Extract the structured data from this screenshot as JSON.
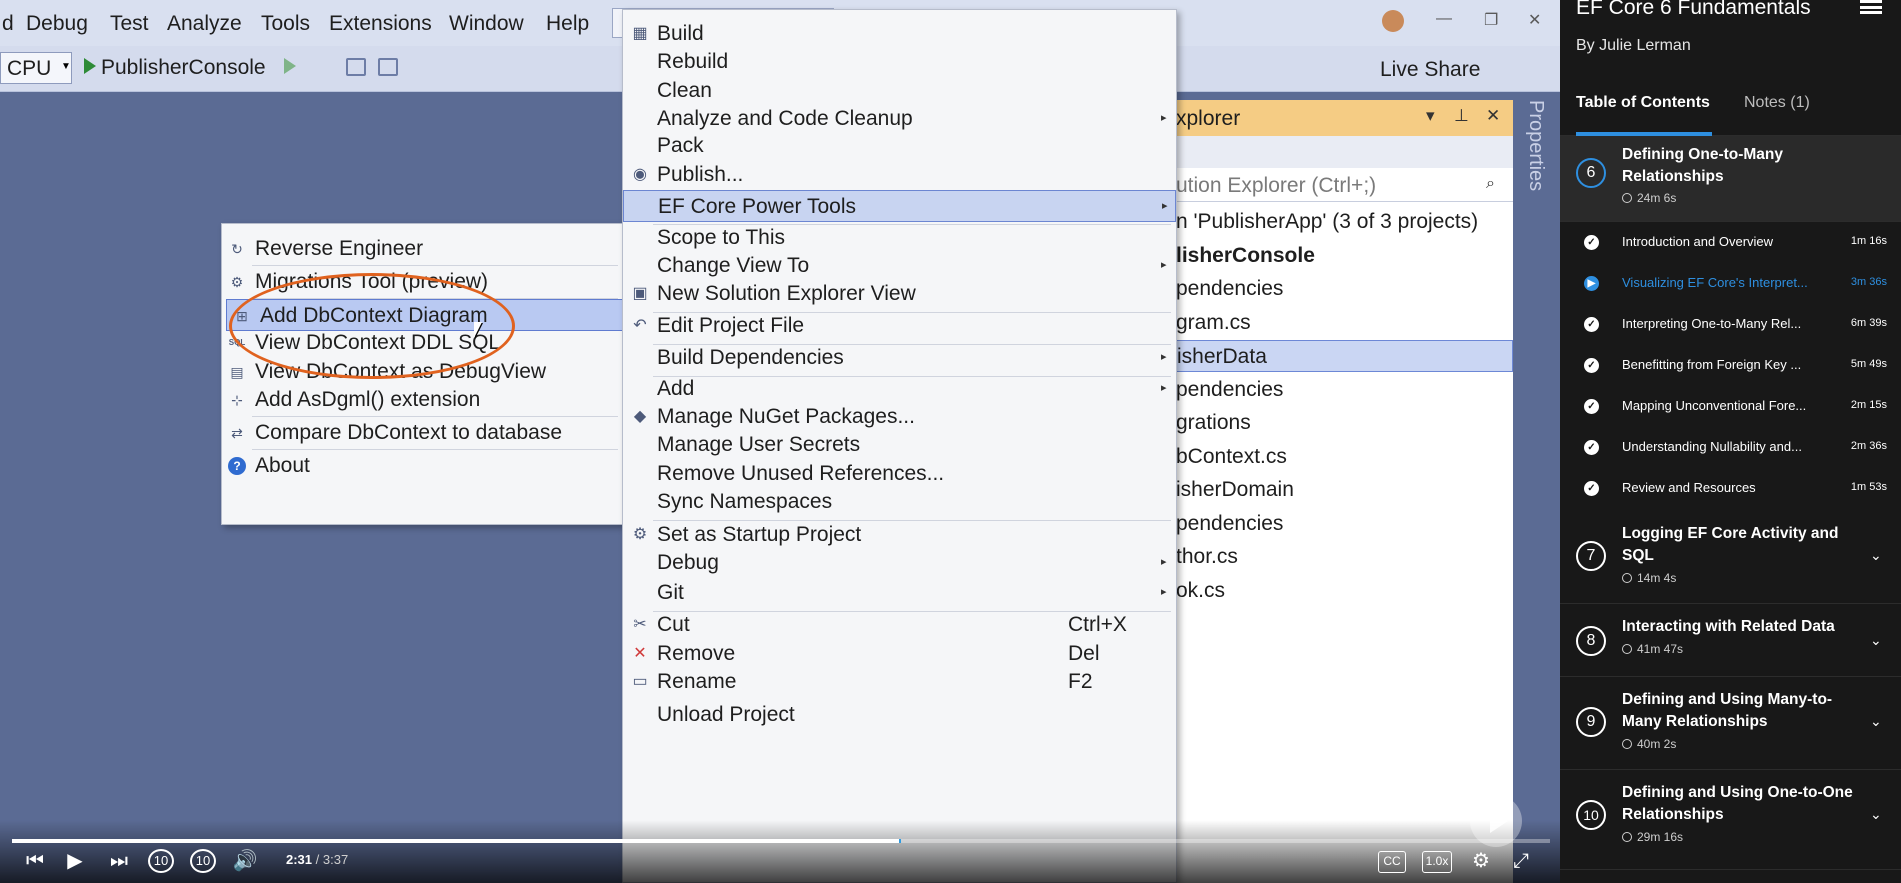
{
  "vs": {
    "menubar": [
      "d",
      "Debug",
      "Test",
      "Analyze",
      "Tools",
      "Extensions",
      "Window",
      "Help"
    ],
    "toolbar": {
      "platform": "CPU",
      "project": "PublisherConsole"
    },
    "live_share": "Live Share",
    "properties_tab": "Properties"
  },
  "solution_explorer": {
    "title": "xplorer",
    "search_placeholder": "ution Explorer (Ctrl+;)",
    "rows": [
      {
        "text": "n 'PublisherApp' (3 of 3 projects)",
        "bold": false,
        "selected": false
      },
      {
        "text": "lisherConsole",
        "bold": true,
        "selected": false
      },
      {
        "text": "pendencies",
        "bold": false,
        "selected": false
      },
      {
        "text": "gram.cs",
        "bold": false,
        "selected": false
      },
      {
        "text": "isherData",
        "bold": false,
        "selected": true
      },
      {
        "text": "pendencies",
        "bold": false,
        "selected": false
      },
      {
        "text": "grations",
        "bold": false,
        "selected": false
      },
      {
        "text": "bContext.cs",
        "bold": false,
        "selected": false
      },
      {
        "text": "isherDomain",
        "bold": false,
        "selected": false
      },
      {
        "text": "pendencies",
        "bold": false,
        "selected": false
      },
      {
        "text": "thor.cs",
        "bold": false,
        "selected": false
      },
      {
        "text": "ok.cs",
        "bold": false,
        "selected": false
      }
    ]
  },
  "context_menu": {
    "items": [
      {
        "label": "Build",
        "icon": "build-icon",
        "glyph": "▦"
      },
      {
        "label": "Rebuild"
      },
      {
        "label": "Clean"
      },
      {
        "label": "Analyze and Code Cleanup",
        "submenu": true
      },
      {
        "label": "Pack"
      },
      {
        "label": "Publish...",
        "icon": "globe-icon",
        "glyph": "◉"
      },
      {
        "label": "EF Core Power Tools",
        "submenu": true,
        "highlighted": true
      },
      {
        "label": "Scope to This"
      },
      {
        "label": "Change View To",
        "submenu": true
      },
      {
        "label": "New Solution Explorer View",
        "icon": "window-icon",
        "glyph": "▣"
      },
      {
        "label": "Edit Project File",
        "icon": "undo-icon",
        "glyph": "↶"
      },
      {
        "label": "Build Dependencies",
        "submenu": true
      },
      {
        "label": "Add",
        "submenu": true
      },
      {
        "label": "Manage NuGet Packages...",
        "icon": "nuget-icon",
        "glyph": "◆"
      },
      {
        "label": "Manage User Secrets"
      },
      {
        "label": "Remove Unused References..."
      },
      {
        "label": "Sync Namespaces"
      },
      {
        "label": "Set as Startup Project",
        "icon": "gear-icon",
        "glyph": "⚙"
      },
      {
        "label": "Debug",
        "submenu": true
      },
      {
        "label": "Git",
        "submenu": true
      },
      {
        "label": "Cut",
        "shortcut": "Ctrl+X",
        "icon": "scissors-icon",
        "glyph": "✂"
      },
      {
        "label": "Remove",
        "shortcut": "Del",
        "icon": "close-icon",
        "glyph": "✕"
      },
      {
        "label": "Rename",
        "shortcut": "F2",
        "icon": "rename-icon",
        "glyph": "▭"
      },
      {
        "label": "Unload Project"
      }
    ]
  },
  "submenu": {
    "items": [
      {
        "label": "Reverse Engineer",
        "icon": "reverse-engineer-icon",
        "glyph": "↻"
      },
      {
        "label": "Migrations Tool (preview)",
        "icon": "migrations-icon",
        "glyph": "⚙"
      },
      {
        "label": "Add DbContext Diagram",
        "icon": "diagram-icon",
        "glyph": "⊞",
        "highlighted": true
      },
      {
        "label": "View DbContext DDL SQL",
        "icon": "sql-icon",
        "glyph": "SQL"
      },
      {
        "label": "View DbContext as DebugView",
        "icon": "document-icon",
        "glyph": "▤"
      },
      {
        "label": "Add AsDgml() extension",
        "icon": "dgml-icon",
        "glyph": "⊹"
      },
      {
        "label": "Compare DbContext to database",
        "icon": "compare-icon",
        "glyph": "⇄"
      },
      {
        "label": "About",
        "icon": "help-icon",
        "glyph": "?"
      }
    ]
  },
  "player": {
    "current_time": "2:31",
    "total_time": "3:37",
    "progress": 0.577,
    "buffered": 0.578,
    "speed": "1.0x",
    "captions": "CC"
  },
  "sidebar": {
    "course_title": "EF Core 6 Fundamentals",
    "author": "By Julie Lerman",
    "tabs": [
      "Table of Contents",
      "Notes (1)"
    ],
    "current_module": {
      "number": "6",
      "title": "Defining One-to-Many Relationships",
      "duration": "24m 6s",
      "clips": [
        {
          "title": "Introduction and Overview",
          "duration": "1m 16s",
          "playing": false
        },
        {
          "title": "Visualizing EF Core's Interpret...",
          "duration": "3m 36s",
          "playing": true
        },
        {
          "title": "Interpreting One-to-Many Rel...",
          "duration": "6m 39s",
          "playing": false
        },
        {
          "title": "Benefitting from Foreign Key ...",
          "duration": "5m 49s",
          "playing": false
        },
        {
          "title": "Mapping Unconventional Fore...",
          "duration": "2m 15s",
          "playing": false
        },
        {
          "title": "Understanding Nullability and...",
          "duration": "2m 36s",
          "playing": false
        },
        {
          "title": "Review and Resources",
          "duration": "1m 53s",
          "playing": false
        }
      ]
    },
    "modules": [
      {
        "number": "7",
        "title": "Logging EF Core Activity and SQL",
        "duration": "14m 4s"
      },
      {
        "number": "8",
        "title": "Interacting with Related Data",
        "duration": "41m 47s"
      },
      {
        "number": "9",
        "title": "Defining and Using Many-to-Many Relationships",
        "duration": "40m 2s"
      },
      {
        "number": "10",
        "title": "Defining and Using One-to-One Relationships",
        "duration": "29m 16s"
      }
    ]
  }
}
